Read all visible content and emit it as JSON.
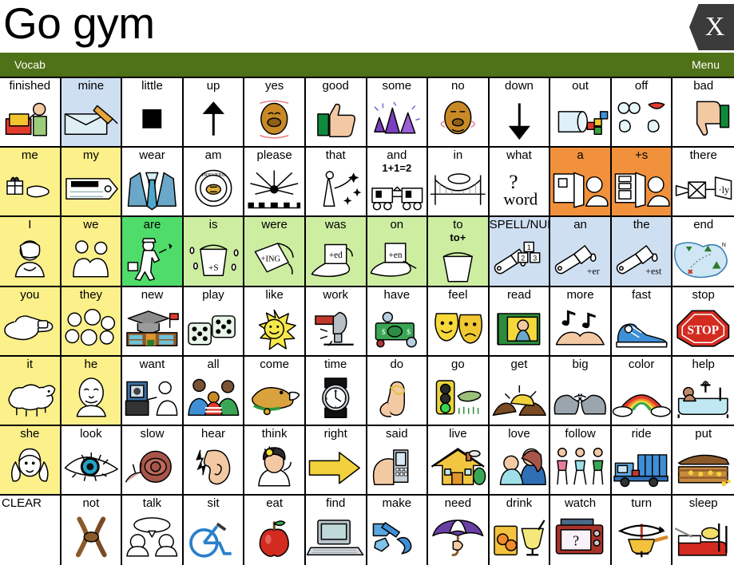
{
  "header": {
    "title": "Go gym",
    "close_label": "X",
    "close_icon": "close-icon"
  },
  "toolbar": {
    "vocab_label": "Vocab",
    "menu_label": "Menu"
  },
  "colors": {
    "toolbar_green": "#4f7117",
    "cell_white": "#ffffff",
    "cell_yellow": "#fbf08a",
    "cell_pale_yellow": "#fdf7b8",
    "cell_lightblue": "#cfdff2",
    "cell_orange": "#f2913c",
    "cell_green_bright": "#4fdc6a",
    "cell_green_pale": "#cdeda1",
    "close_button": "#3b3b3b",
    "border": "#000000"
  },
  "grid": {
    "columns": 12,
    "rows": 7,
    "cells": [
      {
        "label": "finished",
        "color": "#ffffff",
        "icon": "person-putting-away-book-icon"
      },
      {
        "label": "mine",
        "color": "#cfdff2",
        "icon": "hand-writing-envelope-icon"
      },
      {
        "label": "little",
        "color": "#ffffff",
        "icon": "small-black-square-icon"
      },
      {
        "label": "up",
        "color": "#ffffff",
        "icon": "up-arrow-icon"
      },
      {
        "label": "yes",
        "color": "#ffffff",
        "icon": "nodding-head-icon"
      },
      {
        "label": "good",
        "color": "#ffffff",
        "icon": "thumbs-up-icon"
      },
      {
        "label": "some",
        "color": "#ffffff",
        "icon": "purple-cones-group-icon"
      },
      {
        "label": "no",
        "color": "#ffffff",
        "icon": "shaking-head-icon"
      },
      {
        "label": "down",
        "color": "#ffffff",
        "icon": "down-arrow-icon"
      },
      {
        "label": "out",
        "color": "#ffffff",
        "icon": "blocks-out-of-container-icon"
      },
      {
        "label": "off",
        "color": "#ffffff",
        "icon": "eyes-lips-hands-off-icon"
      },
      {
        "label": "bad",
        "color": "#ffffff",
        "icon": "thumbs-down-icon"
      },
      {
        "label": "me",
        "color": "#fbf08a",
        "icon": "hand-giving-gift-icon"
      },
      {
        "label": "my",
        "color": "#fbf08a",
        "icon": "belongs-to-tag-icon"
      },
      {
        "label": "wear",
        "color": "#ffffff",
        "icon": "suit-and-tie-icon"
      },
      {
        "label": "am",
        "color": "#ffffff",
        "icon": "preverb-bee-seal-icon"
      },
      {
        "label": "please",
        "color": "#ffffff",
        "icon": "fireworks-icon"
      },
      {
        "label": "that",
        "color": "#ffffff",
        "icon": "wizard-wand-icon"
      },
      {
        "label": "and",
        "color": "#ffffff",
        "icon": "train-cars-coupling-icon",
        "sublabel": "1+1=2"
      },
      {
        "label": "in",
        "color": "#ffffff",
        "icon": "bridge-with-cloud-icon"
      },
      {
        "label": "what",
        "color": "#ffffff",
        "icon": "question-word-icon"
      },
      {
        "label": "a",
        "color": "#f2913c",
        "icon": "person-at-open-cupboard-icon"
      },
      {
        "label": "+s",
        "color": "#f2913c",
        "icon": "person-at-stocked-cupboard-icon"
      },
      {
        "label": "there",
        "color": "#ffffff",
        "icon": "airplane-banner-ly-icon"
      },
      {
        "label": "I",
        "color": "#fbf08a",
        "icon": "woman-pointing-self-icon"
      },
      {
        "label": "we",
        "color": "#fbf08a",
        "icon": "two-people-together-icon"
      },
      {
        "label": "are",
        "color": "#4fdc6a",
        "icon": "painter-walking-icon"
      },
      {
        "label": "is",
        "color": "#cdeda1",
        "icon": "bucket-plus-s-icon"
      },
      {
        "label": "were",
        "color": "#cdeda1",
        "icon": "pouring-bucket-ing-icon"
      },
      {
        "label": "was",
        "color": "#cdeda1",
        "icon": "spilled-bucket-ed-icon"
      },
      {
        "label": "on",
        "color": "#cdeda1",
        "icon": "spilled-paint-en-icon"
      },
      {
        "label": "to",
        "color": "#cdeda1",
        "icon": "bucket-to-plus-icon",
        "sublabel": "to+"
      },
      {
        "label": "SPELL/NUM",
        "color": "#cfdff2",
        "icon": "paintbrush-numbered-blocks-icon"
      },
      {
        "label": "an",
        "color": "#cfdff2",
        "icon": "paintbrush-er-icon"
      },
      {
        "label": "the",
        "color": "#cfdff2",
        "icon": "paintbrush-est-icon"
      },
      {
        "label": "end",
        "color": "#ffffff",
        "icon": "treasure-map-icon"
      },
      {
        "label": "you",
        "color": "#fbf08a",
        "icon": "pointing-finger-icon"
      },
      {
        "label": "they",
        "color": "#fbf08a",
        "icon": "group-of-faces-icon"
      },
      {
        "label": "new",
        "color": "#ffffff",
        "icon": "graduation-cap-school-icon"
      },
      {
        "label": "play",
        "color": "#ffffff",
        "icon": "dice-icon"
      },
      {
        "label": "like",
        "color": "#ffffff",
        "icon": "smiling-sun-icon"
      },
      {
        "label": "work",
        "color": "#ffffff",
        "icon": "hammer-chisel-icon"
      },
      {
        "label": "have",
        "color": "#ffffff",
        "icon": "money-and-coins-icon"
      },
      {
        "label": "feel",
        "color": "#ffffff",
        "icon": "comedy-tragedy-masks-icon"
      },
      {
        "label": "read",
        "color": "#ffffff",
        "icon": "book-with-portrait-icon"
      },
      {
        "label": "more",
        "color": "#ffffff",
        "icon": "hands-music-notes-icon"
      },
      {
        "label": "fast",
        "color": "#ffffff",
        "icon": "sneaker-icon"
      },
      {
        "label": "stop",
        "color": "#ffffff",
        "icon": "stop-sign-icon"
      },
      {
        "label": "it",
        "color": "#fbf08a",
        "icon": "sheep-icon"
      },
      {
        "label": "he",
        "color": "#fbf08a",
        "icon": "man-face-icon"
      },
      {
        "label": "want",
        "color": "#ffffff",
        "icon": "person-wanting-picture-icon"
      },
      {
        "label": "all",
        "color": "#ffffff",
        "icon": "family-group-icon"
      },
      {
        "label": "come",
        "color": "#ffffff",
        "icon": "dog-fetching-icon"
      },
      {
        "label": "time",
        "color": "#ffffff",
        "icon": "wristwatch-icon"
      },
      {
        "label": "do",
        "color": "#ffffff",
        "icon": "finger-with-string-icon"
      },
      {
        "label": "go",
        "color": "#ffffff",
        "icon": "traffic-light-green-icon"
      },
      {
        "label": "get",
        "color": "#ffffff",
        "icon": "digging-treasure-icon"
      },
      {
        "label": "big",
        "color": "#ffffff",
        "icon": "elephants-icon"
      },
      {
        "label": "color",
        "color": "#ffffff",
        "icon": "rainbow-icon"
      },
      {
        "label": "help",
        "color": "#ffffff",
        "icon": "person-in-bathtub-icon"
      },
      {
        "label": "she",
        "color": "#fbf08a",
        "icon": "girl-face-icon"
      },
      {
        "label": "look",
        "color": "#ffffff",
        "icon": "eye-icon"
      },
      {
        "label": "slow",
        "color": "#ffffff",
        "icon": "snail-icon"
      },
      {
        "label": "hear",
        "color": "#ffffff",
        "icon": "ear-with-sound-icon"
      },
      {
        "label": "think",
        "color": "#ffffff",
        "icon": "person-thinking-lightbulb-icon"
      },
      {
        "label": "right",
        "color": "#ffffff",
        "icon": "right-arrow-icon"
      },
      {
        "label": "said",
        "color": "#ffffff",
        "icon": "hand-holding-phone-icon"
      },
      {
        "label": "live",
        "color": "#ffffff",
        "icon": "house-icon"
      },
      {
        "label": "love",
        "color": "#ffffff",
        "icon": "mother-and-baby-icon"
      },
      {
        "label": "follow",
        "color": "#ffffff",
        "icon": "people-walking-line-icon"
      },
      {
        "label": "ride",
        "color": "#ffffff",
        "icon": "truck-icon"
      },
      {
        "label": "put",
        "color": "#ffffff",
        "icon": "treasure-chest-icon"
      },
      {
        "label": "CLEAR",
        "color": "#ffffff",
        "icon": "none",
        "align": "left"
      },
      {
        "label": "not",
        "color": "#ffffff",
        "icon": "knotted-rope-icon"
      },
      {
        "label": "talk",
        "color": "#ffffff",
        "icon": "two-people-speech-bubble-icon"
      },
      {
        "label": "sit",
        "color": "#ffffff",
        "icon": "wheelchair-icon"
      },
      {
        "label": "eat",
        "color": "#ffffff",
        "icon": "red-apple-icon"
      },
      {
        "label": "find",
        "color": "#ffffff",
        "icon": "computer-icon"
      },
      {
        "label": "make",
        "color": "#ffffff",
        "icon": "blue-shapes-icon"
      },
      {
        "label": "need",
        "color": "#ffffff",
        "icon": "umbrella-icon"
      },
      {
        "label": "drink",
        "color": "#ffffff",
        "icon": "juice-glasses-icon"
      },
      {
        "label": "watch",
        "color": "#ffffff",
        "icon": "television-question-icon"
      },
      {
        "label": "turn",
        "color": "#ffffff",
        "icon": "rotating-pan-icon"
      },
      {
        "label": "sleep",
        "color": "#ffffff",
        "icon": "bed-icon"
      }
    ]
  }
}
